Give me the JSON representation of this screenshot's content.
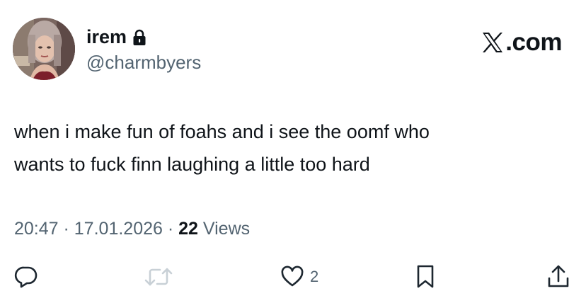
{
  "user": {
    "display_name": "irem",
    "handle": "@charmbyers",
    "protected_icon": "lock-icon",
    "avatar": "profile-photo"
  },
  "brand": {
    "icon": "x-logo-icon",
    "text": ".com"
  },
  "tweet": {
    "line1": "when i make fun of foahs and i see the oomf who",
    "line2": "wants to fuck finn laughing a little too hard"
  },
  "meta": {
    "time": "20:47",
    "separator1": " · ",
    "date": "17.01.2026",
    "separator2": " · ",
    "views_count": "22",
    "views_label": " Views"
  },
  "actions": {
    "reply_icon": "reply-icon",
    "retweet_icon": "retweet-icon",
    "like_icon": "heart-icon",
    "like_count": "2",
    "bookmark_icon": "bookmark-icon",
    "share_icon": "share-icon"
  },
  "colors": {
    "text_primary": "#0f1419",
    "text_secondary": "#536471",
    "retweet_disabled": "#c8d0d6"
  }
}
